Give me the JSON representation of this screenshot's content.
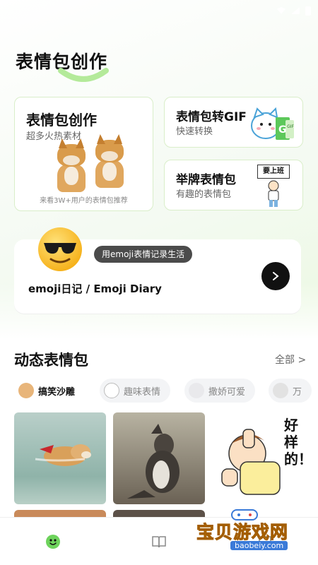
{
  "header": {
    "title": "表情包创作"
  },
  "cards": {
    "create": {
      "title": "表情包创作",
      "subtitle": "超多火热素材",
      "footnote": "来看3W+用户的表情包推荐"
    },
    "gif": {
      "title": "表情包转GIF",
      "subtitle": "快速转换",
      "badge": "GIF"
    },
    "sign": {
      "title": "举牌表情包",
      "subtitle": "有趣的表情包",
      "sign_text": "要上班"
    }
  },
  "diary": {
    "bubble": "用emoji表情记录生活",
    "title": "emoji日记 / Emoji Diary"
  },
  "section": {
    "title": "动态表情包",
    "all_label": "全部 >",
    "chips": [
      {
        "label": "搞笑沙雕",
        "icon": "doge-icon",
        "active": true
      },
      {
        "label": "趣味表情",
        "icon": "cat-icon",
        "active": false
      },
      {
        "label": "撒娇可爱",
        "icon": "ghost-icon",
        "active": false
      },
      {
        "label": "万",
        "icon": "character-icon",
        "active": false
      }
    ],
    "grid_images": [
      {
        "name": "flying-doge-image"
      },
      {
        "name": "kangaroo-image"
      },
      {
        "name": "thumbs-up-sticker",
        "text": "好样的！"
      }
    ]
  },
  "nav": {
    "items": [
      {
        "name": "home",
        "icon": "smile-face-icon",
        "active": true
      },
      {
        "name": "library",
        "icon": "book-icon",
        "active": false
      },
      {
        "name": "messages",
        "icon": "chat-icon",
        "active": false
      }
    ]
  },
  "watermark": {
    "cn": "宝贝游戏网",
    "url": "baobeiy.com"
  },
  "colors": {
    "accent": "#6ed35c",
    "card_border": "#d9eec9",
    "bubble_bg": "#4b4b4b"
  }
}
